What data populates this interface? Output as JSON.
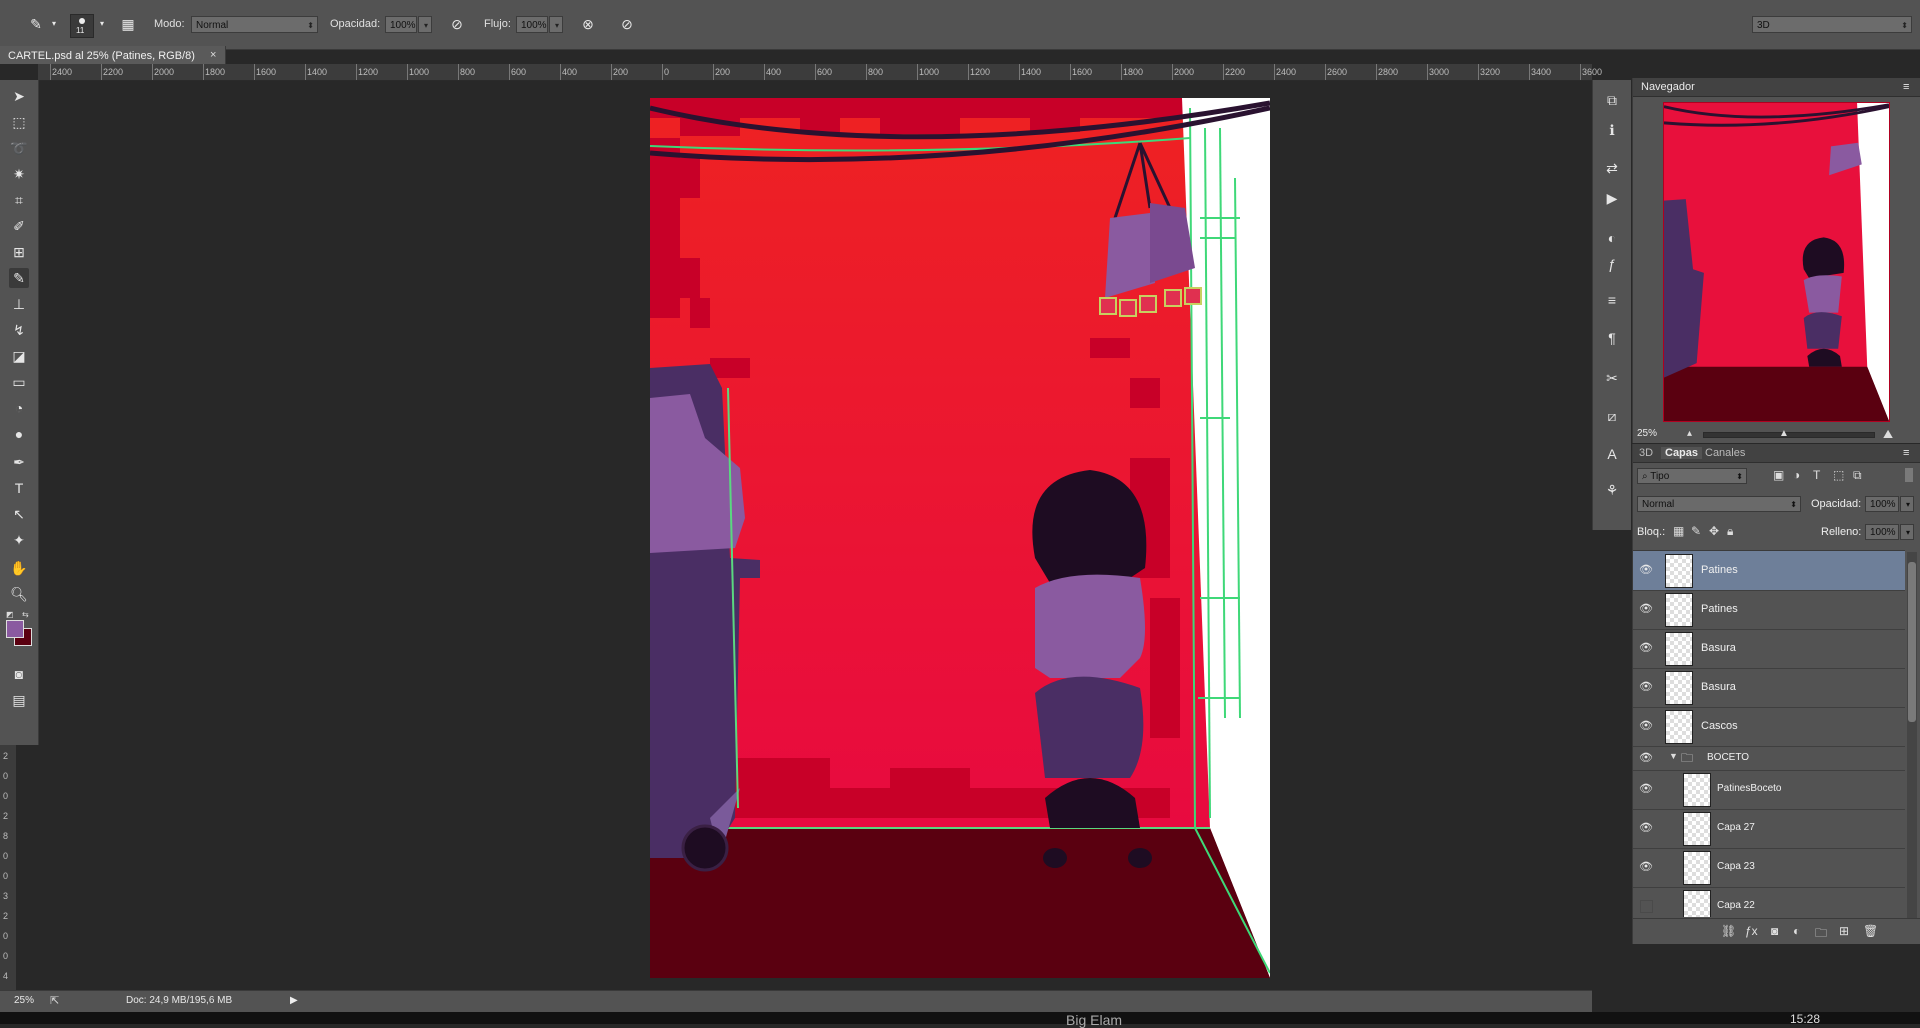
{
  "options_bar": {
    "brush_size": "11",
    "mode_label": "Modo:",
    "mode_value": "Normal",
    "opacity_label": "Opacidad:",
    "opacity_value": "100%",
    "flow_label": "Flujo:",
    "flow_value": "100%",
    "workspace_value": "3D"
  },
  "document_tab": {
    "title": "CARTEL.psd al 25% (Patines, RGB/8)",
    "close": "×"
  },
  "ruler_top": [
    "2400",
    "2200",
    "2000",
    "1800",
    "1600",
    "1400",
    "1200",
    "1000",
    "800",
    "600",
    "400",
    "200",
    "0",
    "200",
    "400",
    "600",
    "800",
    "1000",
    "1200",
    "1400",
    "1600",
    "1800",
    "2000",
    "2200",
    "2400",
    "2600",
    "2800",
    "3000",
    "3200",
    "3400",
    "3600"
  ],
  "ruler_left": [
    "2",
    "0",
    "0",
    "2",
    "8",
    "0",
    "0",
    "3",
    "2",
    "0",
    "0",
    "4"
  ],
  "navigator": {
    "title": "Navegador",
    "zoom": "25%"
  },
  "layers": {
    "tabs": [
      "3D",
      "Capas",
      "Canales"
    ],
    "active_tab": "Capas",
    "filter_value": "Tipo",
    "blend_mode": "Normal",
    "opacity_label": "Opacidad:",
    "opacity_value": "100%",
    "lock_label": "Bloq.:",
    "fill_label": "Relleno:",
    "fill_value": "100%",
    "rows": [
      {
        "name": "Patines",
        "visible": true,
        "selected": true
      },
      {
        "name": "Patines",
        "visible": true,
        "selected": false
      },
      {
        "name": "Basura",
        "visible": true,
        "selected": false
      },
      {
        "name": "Basura",
        "visible": true,
        "selected": false
      },
      {
        "name": "Cascos",
        "visible": true,
        "selected": false
      },
      {
        "name": "BOCETO",
        "visible": true,
        "group": true
      },
      {
        "name": "PatinesBoceto",
        "visible": true,
        "selected": false
      },
      {
        "name": "Capa 27",
        "visible": true,
        "selected": false
      },
      {
        "name": "Capa 23",
        "visible": true,
        "selected": false
      },
      {
        "name": "Capa 22",
        "visible": false,
        "selected": false
      }
    ]
  },
  "status_bar": {
    "zoom": "25%",
    "doc_info": "Doc: 24,9 MB/195,6 MB"
  },
  "taskbar": {
    "text": "Big Elam",
    "clock": "15:28"
  },
  "colors": {
    "foreground": "#8a5aa0",
    "background": "#5a0010",
    "canvas_red": "#e8103c",
    "selected_layer": "#6e7f99"
  }
}
